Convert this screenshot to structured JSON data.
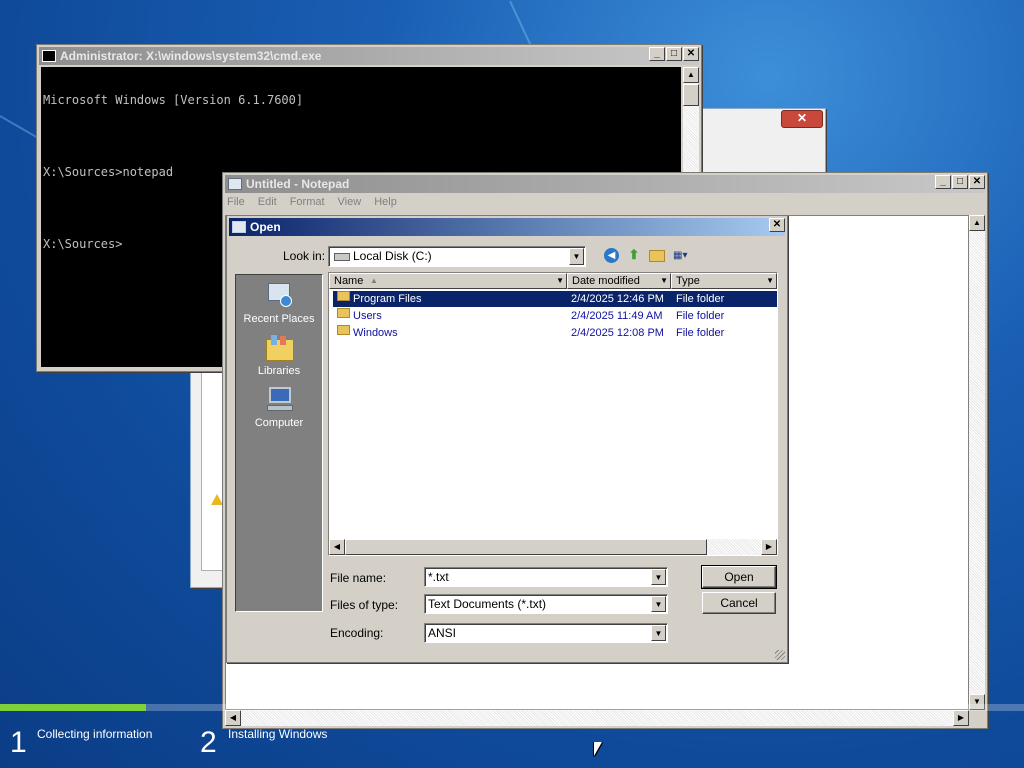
{
  "desktop": {
    "setup_steps": [
      {
        "number": "1",
        "label": "Collecting information"
      },
      {
        "number": "2",
        "label": "Installing Windows"
      }
    ]
  },
  "cmd": {
    "title": "Administrator: X:\\windows\\system32\\cmd.exe",
    "lines": [
      "Microsoft Windows [Version 6.1.7600]",
      "",
      "X:\\Sources>notepad",
      "",
      "X:\\Sources>"
    ],
    "icon_text": "C:\\"
  },
  "notepad": {
    "title": "Untitled - Notepad",
    "menu": [
      "File",
      "Edit",
      "Format",
      "View",
      "Help"
    ]
  },
  "open_dialog": {
    "title": "Open",
    "look_in_label": "Look in:",
    "look_in_value": "Local Disk (C:)",
    "places": [
      "Recent Places",
      "Libraries",
      "Computer"
    ],
    "columns": [
      "Name",
      "Date modified",
      "Type"
    ],
    "rows": [
      {
        "name": "Program Files",
        "date": "2/4/2025 12:46 PM",
        "type": "File folder"
      },
      {
        "name": "Users",
        "date": "2/4/2025 11:49 AM",
        "type": "File folder"
      },
      {
        "name": "Windows",
        "date": "2/4/2025 12:08 PM",
        "type": "File folder"
      }
    ],
    "file_name_label": "File name:",
    "file_name_value": "*.txt",
    "files_of_type_label": "Files of type:",
    "files_of_type_value": "Text Documents (*.txt)",
    "encoding_label": "Encoding:",
    "encoding_value": "ANSI",
    "open_button": "Open",
    "cancel_button": "Cancel"
  },
  "colors": {
    "selection": "#0a246a",
    "link_text": "#1010a0",
    "progress": "#7fd13b"
  }
}
